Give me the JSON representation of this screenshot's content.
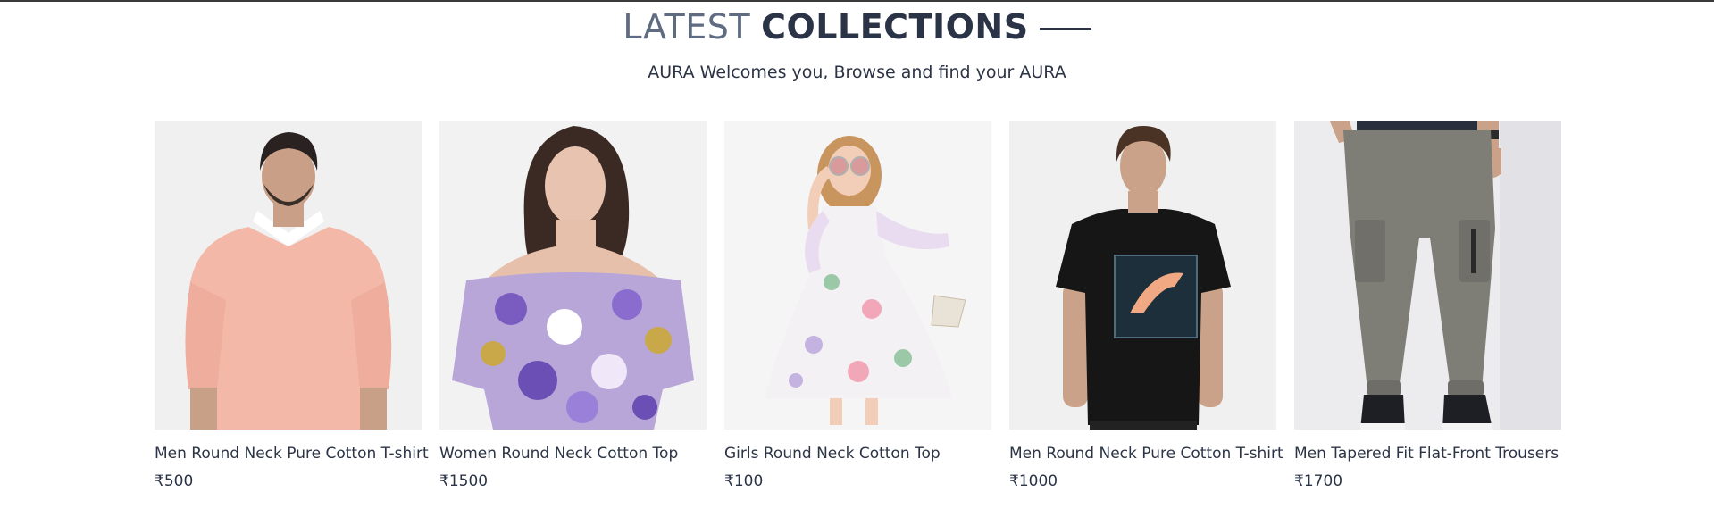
{
  "section": {
    "title_light": "LATEST",
    "title_bold": "COLLECTIONS",
    "subtitle": "AURA Welcomes you, Browse and find your AURA"
  },
  "products": [
    {
      "name": "Men Round Neck Pure Cotton T-shirt",
      "price": "₹500",
      "image": "man-pink-polo-shirt"
    },
    {
      "name": "Women Round Neck Cotton Top",
      "price": "₹1500",
      "image": "woman-floral-off-shoulder-top"
    },
    {
      "name": "Girls Round Neck Cotton Top",
      "price": "₹100",
      "image": "girl-floral-dress-sunglasses"
    },
    {
      "name": "Men Round Neck Pure Cotton T-shirt",
      "price": "₹1000",
      "image": "man-black-graphic-tshirt"
    },
    {
      "name": "Men Tapered Fit Flat-Front Trousers",
      "price": "₹1700",
      "image": "grey-cargo-jogger-trousers"
    }
  ],
  "colors": {
    "heading_light": "#5e6b80",
    "heading_dark": "#2b3446",
    "photo_bg": "#f1f1f1"
  }
}
